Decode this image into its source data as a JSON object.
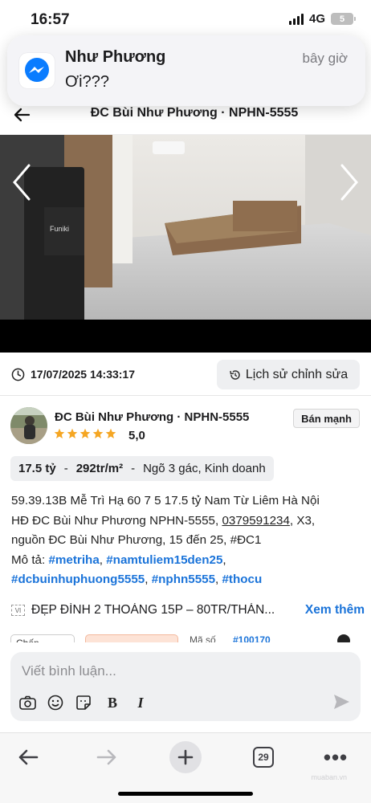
{
  "status_bar": {
    "time": "16:57",
    "network": "4G",
    "battery": "5"
  },
  "notification": {
    "app_icon": "messenger-icon",
    "sender": "Như Phương",
    "message": "Ơi???",
    "time": "bây giờ"
  },
  "header": {
    "title": "ĐC Bùi Như Phương · NPHN-5555"
  },
  "post": {
    "timestamp": "17/07/2025 14:33:17",
    "history_label": "Lịch sử chỉnh sửa",
    "author": "ĐC Bùi Như Phương · NPHN-5555",
    "rating": "5,0",
    "stars": 5,
    "tag": "Bán mạnh",
    "price": {
      "total": "17.5 tỷ",
      "sep1": "-",
      "per_m2": "292tr/m²",
      "sep2": "-",
      "features": "Ngõ 3 gác, Kinh doanh"
    },
    "description": {
      "line1": "59.39.13B Mễ Trì Hạ 60 7 5 17.5 tỷ Nam Từ Liêm Hà Nội",
      "line2_pre": "HĐ ĐC Bùi Như Phương NPHN-5555,",
      "phone": "0379591234",
      "line2_post": ", X3,",
      "line3": "nguồn ĐC Bùi Như Phương, 15 đến 25, #ĐC1",
      "mota_label": "Mô tả:",
      "hashtags": [
        "#metriha",
        "#namtuliem15den25",
        "#dcbuinhuphuong5555",
        "#nphn5555",
        "#thocu"
      ]
    },
    "listing_title": "ĐẸP ĐÌNH 2 THOÁNG 15P – 80TR/THÁN...",
    "see_more": "Xem thêm",
    "partial_row": {
      "a": "Chốn",
      "b": "Mã số",
      "c": "#100170"
    }
  },
  "comment": {
    "placeholder": "Viết bình luận...",
    "tools": [
      "camera-icon",
      "emoji-icon",
      "sticker-icon",
      "bold-icon",
      "italic-icon"
    ],
    "bold": "B",
    "italic": "I"
  },
  "toolbar": {
    "tabs_count": "29",
    "more": "•••",
    "watermark": "muaban.vn"
  },
  "colors": {
    "accent": "#1a73d9",
    "star": "#f5a623",
    "messenger": "#0a7cff"
  }
}
